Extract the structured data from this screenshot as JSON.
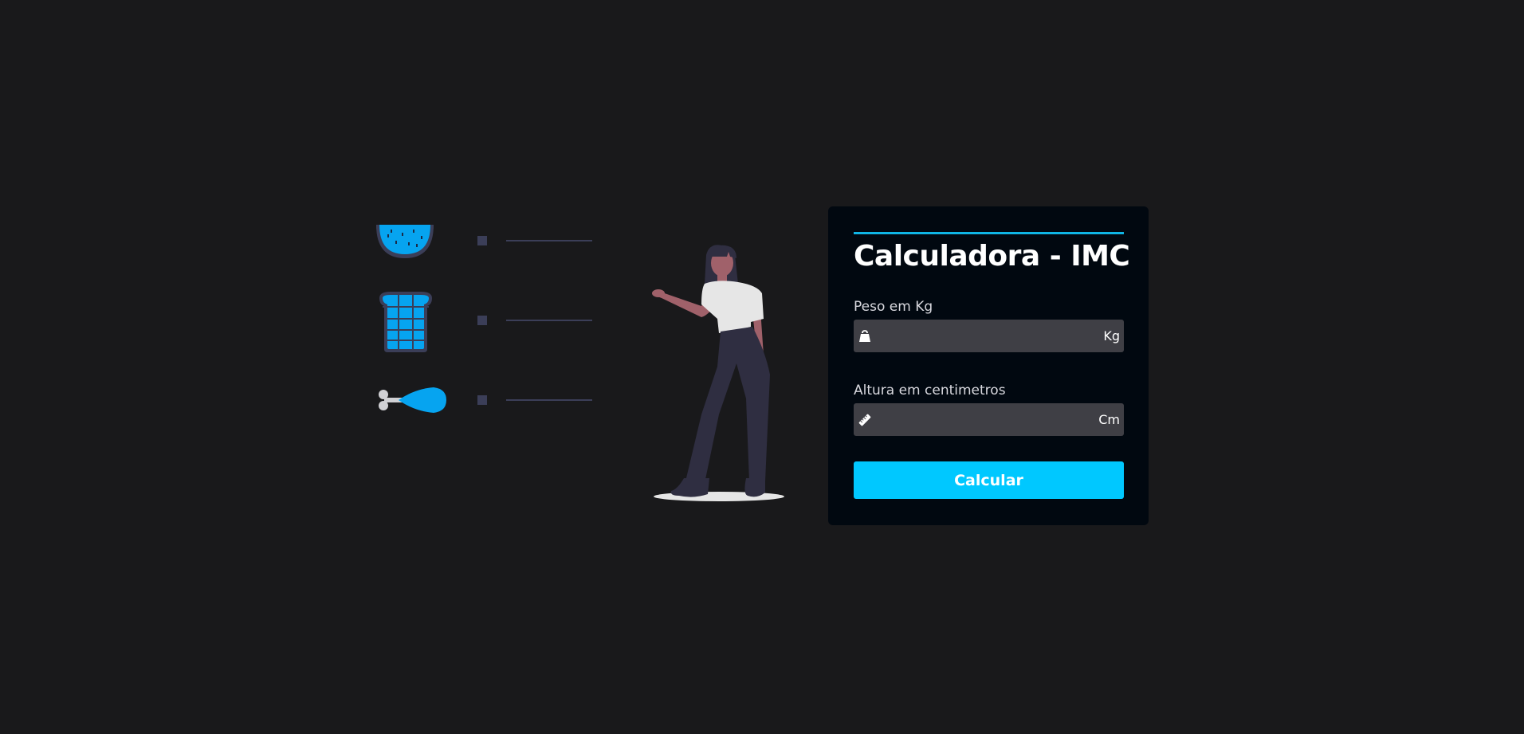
{
  "form": {
    "title": "Calculadora - IMC",
    "weight": {
      "label": "Peso em Kg",
      "value": "",
      "placeholder": "",
      "unit": "Kg",
      "icon": "weight-icon"
    },
    "height": {
      "label": "Altura em centimetros",
      "value": "",
      "placeholder": "",
      "unit": "Cm",
      "icon": "ruler-icon"
    },
    "submit_label": "Calcular"
  },
  "illustration": {
    "foods": [
      "watermelon-icon",
      "bread-icon",
      "chicken-leg-icon"
    ]
  },
  "colors": {
    "background": "#19191b",
    "card": "#010810",
    "accent": "#00c8ff",
    "input_bg": "#3f3f45"
  }
}
